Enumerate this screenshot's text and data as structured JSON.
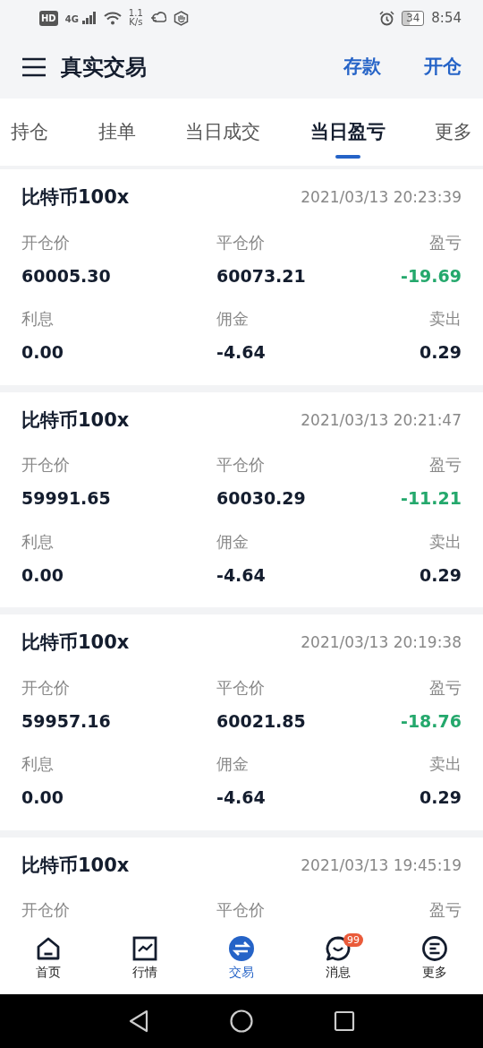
{
  "status_bar": {
    "left": [
      {
        "kind": "hd",
        "text": "HD"
      },
      {
        "kind": "signal",
        "text": "4G"
      },
      {
        "kind": "wifi"
      },
      {
        "kind": "speed",
        "text": "1.1\nK/s"
      },
      {
        "kind": "app"
      },
      {
        "kind": "hand"
      }
    ],
    "battery": "34",
    "time": "8:54"
  },
  "header": {
    "title": "真实交易",
    "actions": [
      "存款",
      "开仓"
    ]
  },
  "tabs": [
    {
      "label": "持仓",
      "selected": false
    },
    {
      "label": "挂单",
      "selected": false
    },
    {
      "label": "当日成交",
      "selected": false
    },
    {
      "label": "当日盈亏",
      "selected": true
    },
    {
      "label": "更多",
      "selected": false
    }
  ],
  "trades": [
    {
      "symbol": "比特币100x",
      "time": "2021/03/13 20:23:39",
      "fields": [
        {
          "label": "开仓价",
          "value": "60005.30",
          "loss": false
        },
        {
          "label": "平仓价",
          "value": "60073.21",
          "loss": false
        },
        {
          "label": "盈亏",
          "value": "-19.69",
          "loss": true
        },
        {
          "label": "利息",
          "value": "0.00",
          "loss": false
        },
        {
          "label": "佣金",
          "value": "-4.64",
          "loss": false
        },
        {
          "label": "卖出",
          "value": "0.29",
          "loss": false
        }
      ]
    },
    {
      "symbol": "比特币100x",
      "time": "2021/03/13 20:21:47",
      "fields": [
        {
          "label": "开仓价",
          "value": "59991.65",
          "loss": false
        },
        {
          "label": "平仓价",
          "value": "60030.29",
          "loss": false
        },
        {
          "label": "盈亏",
          "value": "-11.21",
          "loss": true
        },
        {
          "label": "利息",
          "value": "0.00",
          "loss": false
        },
        {
          "label": "佣金",
          "value": "-4.64",
          "loss": false
        },
        {
          "label": "卖出",
          "value": "0.29",
          "loss": false
        }
      ]
    },
    {
      "symbol": "比特币100x",
      "time": "2021/03/13 20:19:38",
      "fields": [
        {
          "label": "开仓价",
          "value": "59957.16",
          "loss": false
        },
        {
          "label": "平仓价",
          "value": "60021.85",
          "loss": false
        },
        {
          "label": "盈亏",
          "value": "-18.76",
          "loss": true
        },
        {
          "label": "利息",
          "value": "0.00",
          "loss": false
        },
        {
          "label": "佣金",
          "value": "-4.64",
          "loss": false
        },
        {
          "label": "卖出",
          "value": "0.29",
          "loss": false
        }
      ]
    },
    {
      "symbol": "比特币100x",
      "time": "2021/03/13 19:45:19",
      "fields": [
        {
          "label": "开仓价"
        },
        {
          "label": "平仓价"
        },
        {
          "label": "盈亏"
        }
      ]
    }
  ],
  "bottom_nav": [
    {
      "kind": "home",
      "label": "首页",
      "selected": false
    },
    {
      "kind": "chart",
      "label": "行情",
      "selected": false
    },
    {
      "kind": "trade",
      "label": "交易",
      "selected": true
    },
    {
      "kind": "message",
      "label": "消息",
      "selected": false,
      "badge": "99"
    },
    {
      "kind": "more",
      "label": "更多",
      "selected": false
    }
  ]
}
